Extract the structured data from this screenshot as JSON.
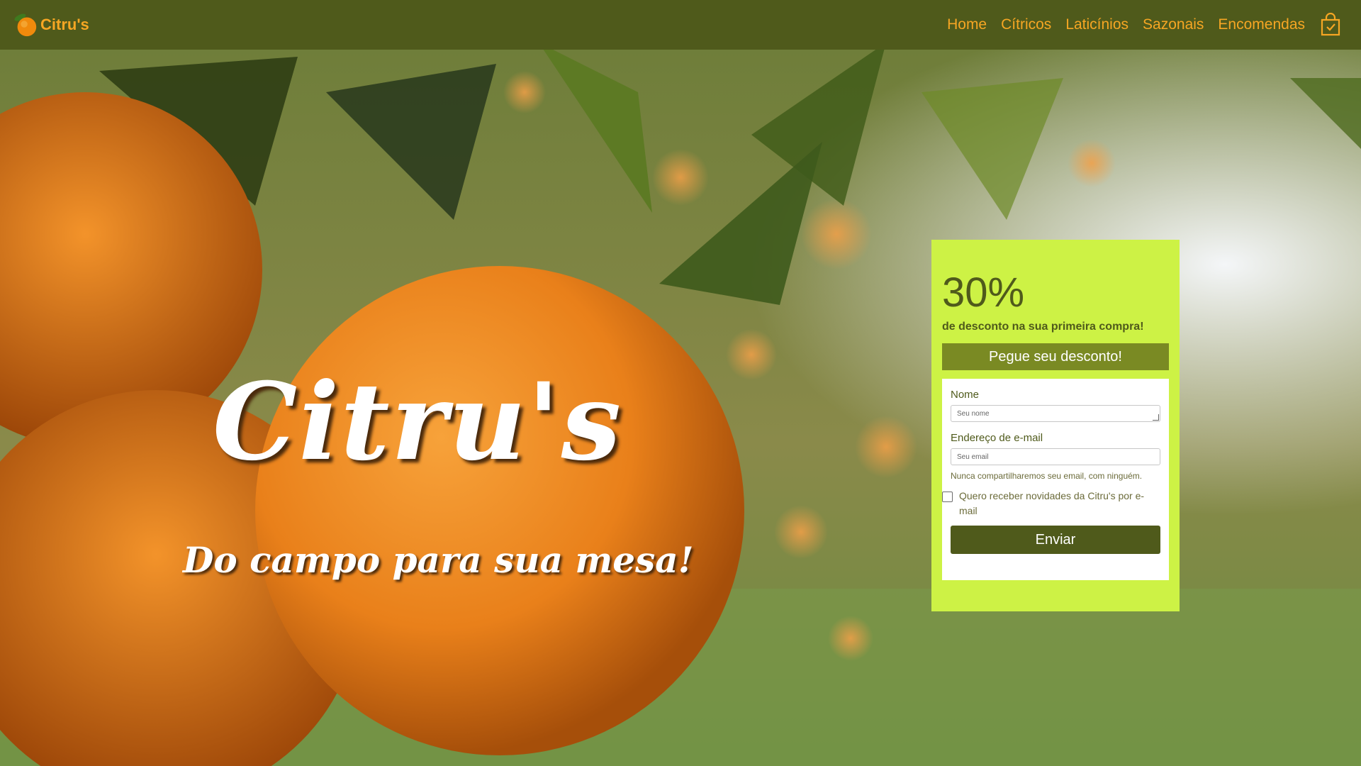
{
  "navbar": {
    "brand": "Citru's",
    "links": [
      "Home",
      "Cítricos",
      "Laticínios",
      "Sazonais",
      "Encomendas"
    ],
    "cart_icon": "shopping-bag-icon",
    "accent_color": "#f6a623",
    "bg_color": "#4f5a1b"
  },
  "hero": {
    "title": "Citru's",
    "subtitle": "Do campo para sua mesa!"
  },
  "promo": {
    "percent": "30%",
    "description": "de desconto na sua primeira compra!",
    "button_label": "Pegue seu desconto!",
    "bg_color": "#cdf245"
  },
  "form": {
    "name_label": "Nome",
    "name_placeholder": "Seu nome",
    "email_label": "Endereço de e-mail",
    "email_placeholder": "Seu email",
    "email_help": "Nunca compartilharemos seu email, com ninguém.",
    "newsletter_label": "Quero receber novidades da Citru's por e-mail",
    "submit_label": "Enviar"
  }
}
